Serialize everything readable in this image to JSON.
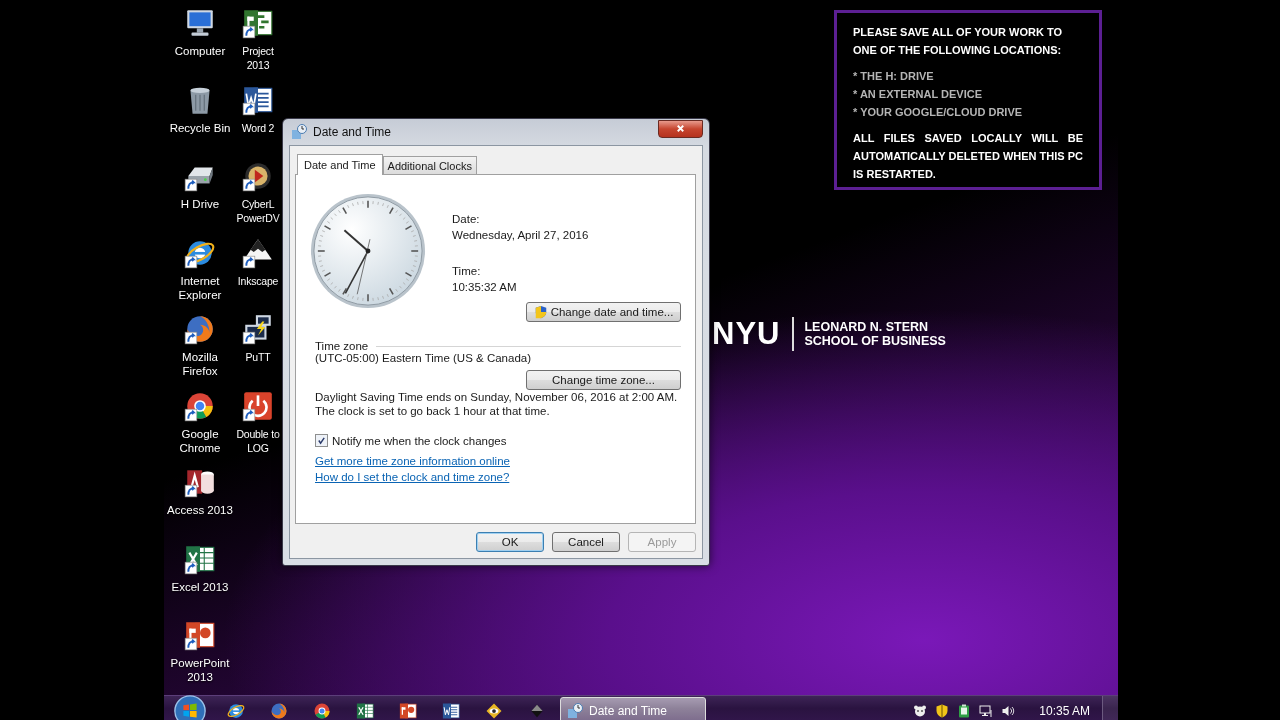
{
  "desktop_columns": [
    {
      "icons": [
        {
          "label": "Computer",
          "kind": "computer",
          "shortcut": false
        },
        {
          "label": "Recycle Bin",
          "kind": "recycle",
          "shortcut": false
        },
        {
          "label": "H Drive",
          "kind": "drive",
          "shortcut": true
        },
        {
          "label": "Internet Explorer",
          "kind": "ie",
          "shortcut": true
        },
        {
          "label": "Mozilla Firefox",
          "kind": "firefox",
          "shortcut": true
        },
        {
          "label": "Google Chrome",
          "kind": "chrome",
          "shortcut": true
        },
        {
          "label": "Access 2013",
          "kind": "access",
          "shortcut": true
        },
        {
          "label": "Excel 2013",
          "kind": "excel",
          "shortcut": true
        },
        {
          "label": "PowerPoint 2013",
          "kind": "powerpoint",
          "shortcut": true
        }
      ]
    },
    {
      "icons": [
        {
          "label": "Project 2013",
          "kind": "project",
          "shortcut": true
        },
        {
          "label": "Word 2",
          "kind": "word",
          "shortcut": true
        },
        {
          "label": "CyberL PowerDV",
          "kind": "cyberlink",
          "shortcut": true
        },
        {
          "label": "Inkscape",
          "kind": "inkscape",
          "shortcut": true
        },
        {
          "label": "PuTT",
          "kind": "putty",
          "shortcut": true
        },
        {
          "label": "Double to LOG",
          "kind": "power",
          "shortcut": true
        }
      ]
    }
  ],
  "notice": {
    "heading": "PLEASE SAVE ALL OF YOUR WORK TO ONE OF THE FOLLOWING LOCATIONS:",
    "items": [
      "* THE H: DRIVE",
      "* AN EXTERNAL DEVICE",
      "* YOUR GOOGLE/CLOUD DRIVE"
    ],
    "footer": "ALL FILES SAVED LOCALLY WILL BE AUTOMATICALLY DELETED WHEN THIS PC IS RESTARTED."
  },
  "wallpaper_logo": {
    "mark": "NYU",
    "line_1": "LEONARD N. STERN",
    "line_2": "SCHOOL OF BUSINESS"
  },
  "dialog": {
    "title": "Date and Time",
    "tabs": [
      {
        "label": "Date and Time",
        "selected": true
      },
      {
        "label": "Additional Clocks",
        "selected": false
      }
    ],
    "date_label": "Date:",
    "date": "Wednesday, April 27, 2016",
    "time_label": "Time:",
    "time": "10:35:32 AM",
    "change_date_button": "Change date and time...",
    "time_zone_heading": "Time zone",
    "time_zone": "(UTC-05:00) Eastern Time (US & Canada)",
    "change_zone_button": "Change time zone...",
    "dst_note": "Daylight Saving Time ends on Sunday, November 06, 2016 at 2:00 AM. The clock is set to go back 1 hour at that time.",
    "notify": {
      "label": "Notify me when the clock changes",
      "checked": true
    },
    "links": [
      "Get more time zone information online",
      "How do I set the clock and time zone?"
    ],
    "buttons": [
      {
        "label": "OK",
        "default": true,
        "disabled": false
      },
      {
        "label": "Cancel",
        "default": false,
        "disabled": false
      },
      {
        "label": "Apply",
        "default": false,
        "disabled": true
      }
    ]
  },
  "taskbar": {
    "pinned": [
      {
        "kind": "ie"
      },
      {
        "kind": "firefox"
      },
      {
        "kind": "chrome"
      },
      {
        "kind": "excel"
      },
      {
        "kind": "powerpoint"
      },
      {
        "kind": "word"
      },
      {
        "kind": "eye"
      },
      {
        "kind": "diamond"
      }
    ],
    "tasks": [
      {
        "label": "Date and Time",
        "selected": true
      }
    ],
    "tray": [
      {
        "kind": "face"
      },
      {
        "kind": "shield"
      },
      {
        "kind": "green"
      },
      {
        "kind": "network"
      },
      {
        "kind": "speaker"
      }
    ],
    "clock": "10:35 AM"
  }
}
